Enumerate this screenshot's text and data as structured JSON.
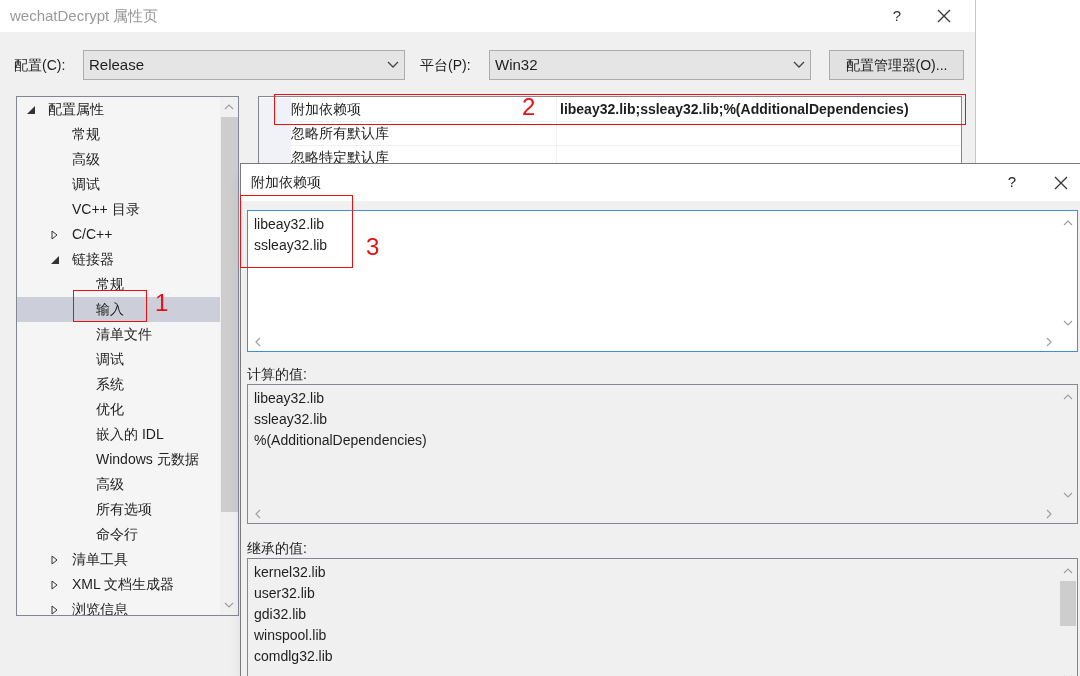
{
  "window": {
    "title": "wechatDecrypt 属性页",
    "help_button": "?"
  },
  "config": {
    "label": "配置(C):",
    "value": "Release"
  },
  "platform": {
    "label": "平台(P):",
    "value": "Win32"
  },
  "manager_button": "配置管理器(O)...",
  "tree": [
    {
      "label": "配置属性",
      "expanded": true,
      "selected": false,
      "children": [
        {
          "label": "常规",
          "selected": false
        },
        {
          "label": "高级",
          "selected": false
        },
        {
          "label": "调试",
          "selected": false
        },
        {
          "label": "VC++ 目录",
          "selected": false
        },
        {
          "label": "C/C++",
          "expanded": false,
          "selected": false
        },
        {
          "label": "链接器",
          "expanded": true,
          "selected": false,
          "children": [
            {
              "label": "常规",
              "selected": false
            },
            {
              "label": "输入",
              "selected": true
            },
            {
              "label": "清单文件",
              "selected": false
            },
            {
              "label": "调试",
              "selected": false
            },
            {
              "label": "系统",
              "selected": false
            },
            {
              "label": "优化",
              "selected": false
            },
            {
              "label": "嵌入的 IDL",
              "selected": false
            },
            {
              "label": "Windows 元数据",
              "selected": false
            },
            {
              "label": "高级",
              "selected": false
            },
            {
              "label": "所有选项",
              "selected": false
            },
            {
              "label": "命令行",
              "selected": false
            }
          ]
        },
        {
          "label": "清单工具",
          "expanded": false,
          "selected": false
        },
        {
          "label": "XML 文档生成器",
          "expanded": false,
          "selected": false
        },
        {
          "label": "浏览信息",
          "expanded": false,
          "selected": false
        }
      ]
    }
  ],
  "properties": [
    {
      "name": "附加依赖项",
      "value": "libeay32.lib;ssleay32.lib;%(AdditionalDependencies)"
    },
    {
      "name": "忽略所有默认库"
    },
    {
      "name": "忽略特定默认库"
    }
  ],
  "dialog": {
    "title": "附加依赖项",
    "help_button": "?",
    "input_lines": [
      "libeay32.lib",
      "ssleay32.lib"
    ],
    "computed_label": "计算的值:",
    "computed_lines": [
      "libeay32.lib",
      "ssleay32.lib",
      "%(AdditionalDependencies)"
    ],
    "inherited_label": "继承的值:",
    "inherited_lines": [
      "kernel32.lib",
      "user32.lib",
      "gdi32.lib",
      "winspool.lib",
      "comdlg32.lib"
    ]
  },
  "annotations": [
    {
      "label": "1"
    },
    {
      "label": "2"
    },
    {
      "label": "3"
    }
  ]
}
